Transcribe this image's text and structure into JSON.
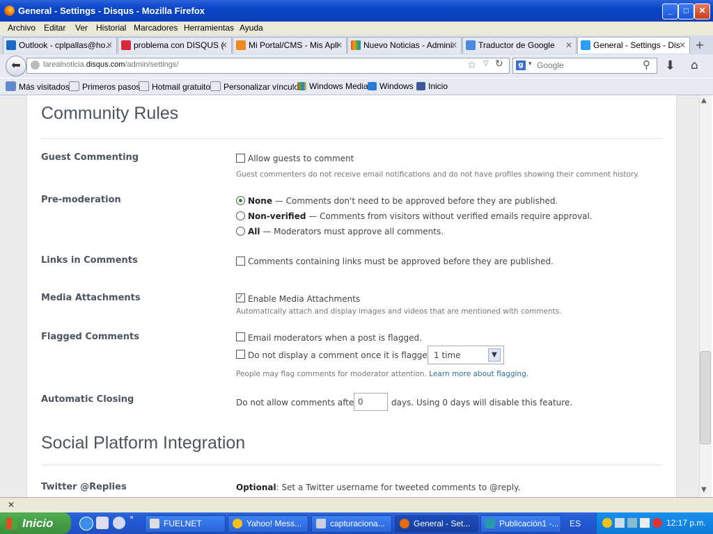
{
  "window": {
    "title": "General - Settings - Disqus - Mozilla Firefox"
  },
  "menu": [
    "Archivo",
    "Editar",
    "Ver",
    "Historial",
    "Marcadores",
    "Herramientas",
    "Ayuda"
  ],
  "tabs": [
    {
      "label": "Outlook - cplpallas@ho...",
      "icon": "outlook-icon"
    },
    {
      "label": "problema con DISQUS (...",
      "icon": "w-icon"
    },
    {
      "label": "Mi Portal/CMS - Mis Apli...",
      "icon": "cp-icon"
    },
    {
      "label": "Nuevo Noticias - Admini...",
      "icon": "joomla-icon"
    },
    {
      "label": "Traductor de Google",
      "icon": "translate-icon"
    },
    {
      "label": "General - Settings - Dis...",
      "icon": "disqus-icon"
    }
  ],
  "nav": {
    "url_prefix": "larealnoticia.",
    "url_domain": "disqus.com",
    "url_path": "/admin/settings/",
    "search_placeholder": "Google"
  },
  "bookmarks": [
    "Más visitados",
    "Primeros pasos",
    "Hotmail gratuito",
    "Personalizar vínculos",
    "Windows Media",
    "Windows",
    "Inicio"
  ],
  "page": {
    "section1_title": "Community Rules",
    "guest": {
      "label": "Guest Commenting",
      "option": "Allow guests to comment",
      "hint": "Guest commenters do not receive email notifications and do not have profiles showing their comment history.",
      "checked": false
    },
    "premod": {
      "label": "Pre-moderation",
      "options": [
        {
          "name": "None",
          "desc": " — Comments don't need to be approved before they are published.",
          "checked": true
        },
        {
          "name": "Non-verified",
          "desc": " — Comments from visitors without verified emails require approval.",
          "checked": false
        },
        {
          "name": "All",
          "desc": " — Moderators must approve all comments.",
          "checked": false
        }
      ]
    },
    "links": {
      "label": "Links in Comments",
      "option": "Comments containing links must be approved before they are published.",
      "checked": false
    },
    "media": {
      "label": "Media Attachments",
      "option": "Enable Media Attachments",
      "hint": "Automatically attach and display images and videos that are mentioned with comments.",
      "checked": true
    },
    "flagged": {
      "label": "Flagged Comments",
      "option1": "Email moderators when a post is flagged.",
      "option2": "Do not display a comment once it is flagged",
      "select_value": "1 time",
      "hint": "People may flag comments for moderator attention. ",
      "hint_link": "Learn more about flagging."
    },
    "closing": {
      "label": "Automatic Closing",
      "prefix": "Do not allow comments after",
      "value": "0",
      "suffix": "days. Using 0 days will disable this feature."
    },
    "section2_title": "Social Platform Integration",
    "twitter": {
      "label": "Twitter @Replies",
      "optional": "Optional",
      "text": ": Set a Twitter username for tweeted comments to @reply."
    }
  },
  "taskbar": {
    "start": "Inicio",
    "tasks": [
      "FUELNET",
      "Yahoo! Mess...",
      "capturaciona...",
      "General - Set...",
      "Publicación1 -..."
    ],
    "lang": "ES",
    "clock": "12:17 p.m."
  },
  "colors": {
    "titlebar": "#0a44c8",
    "check_green": "#2a9a2a",
    "link": "#2c6e9e",
    "taskbar": "#245edb",
    "start": "#3c8f3c"
  }
}
